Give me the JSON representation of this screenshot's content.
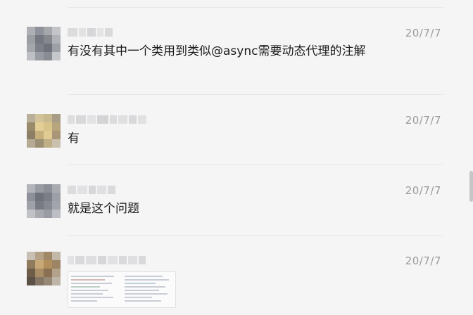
{
  "messages": [
    {
      "time": "20/7/7",
      "text": "有没有其中一个类用到类似@async需要动态代理的注解"
    },
    {
      "time": "20/7/7",
      "text": "有"
    },
    {
      "time": "20/7/7",
      "text": "就是这个问题"
    },
    {
      "time": "20/7/7",
      "text": ""
    }
  ],
  "colors": {
    "background": "#f5f5f5",
    "text": "#1b1b1b",
    "timestamp": "#9a9a9a",
    "divider": "#e6e6e6"
  }
}
